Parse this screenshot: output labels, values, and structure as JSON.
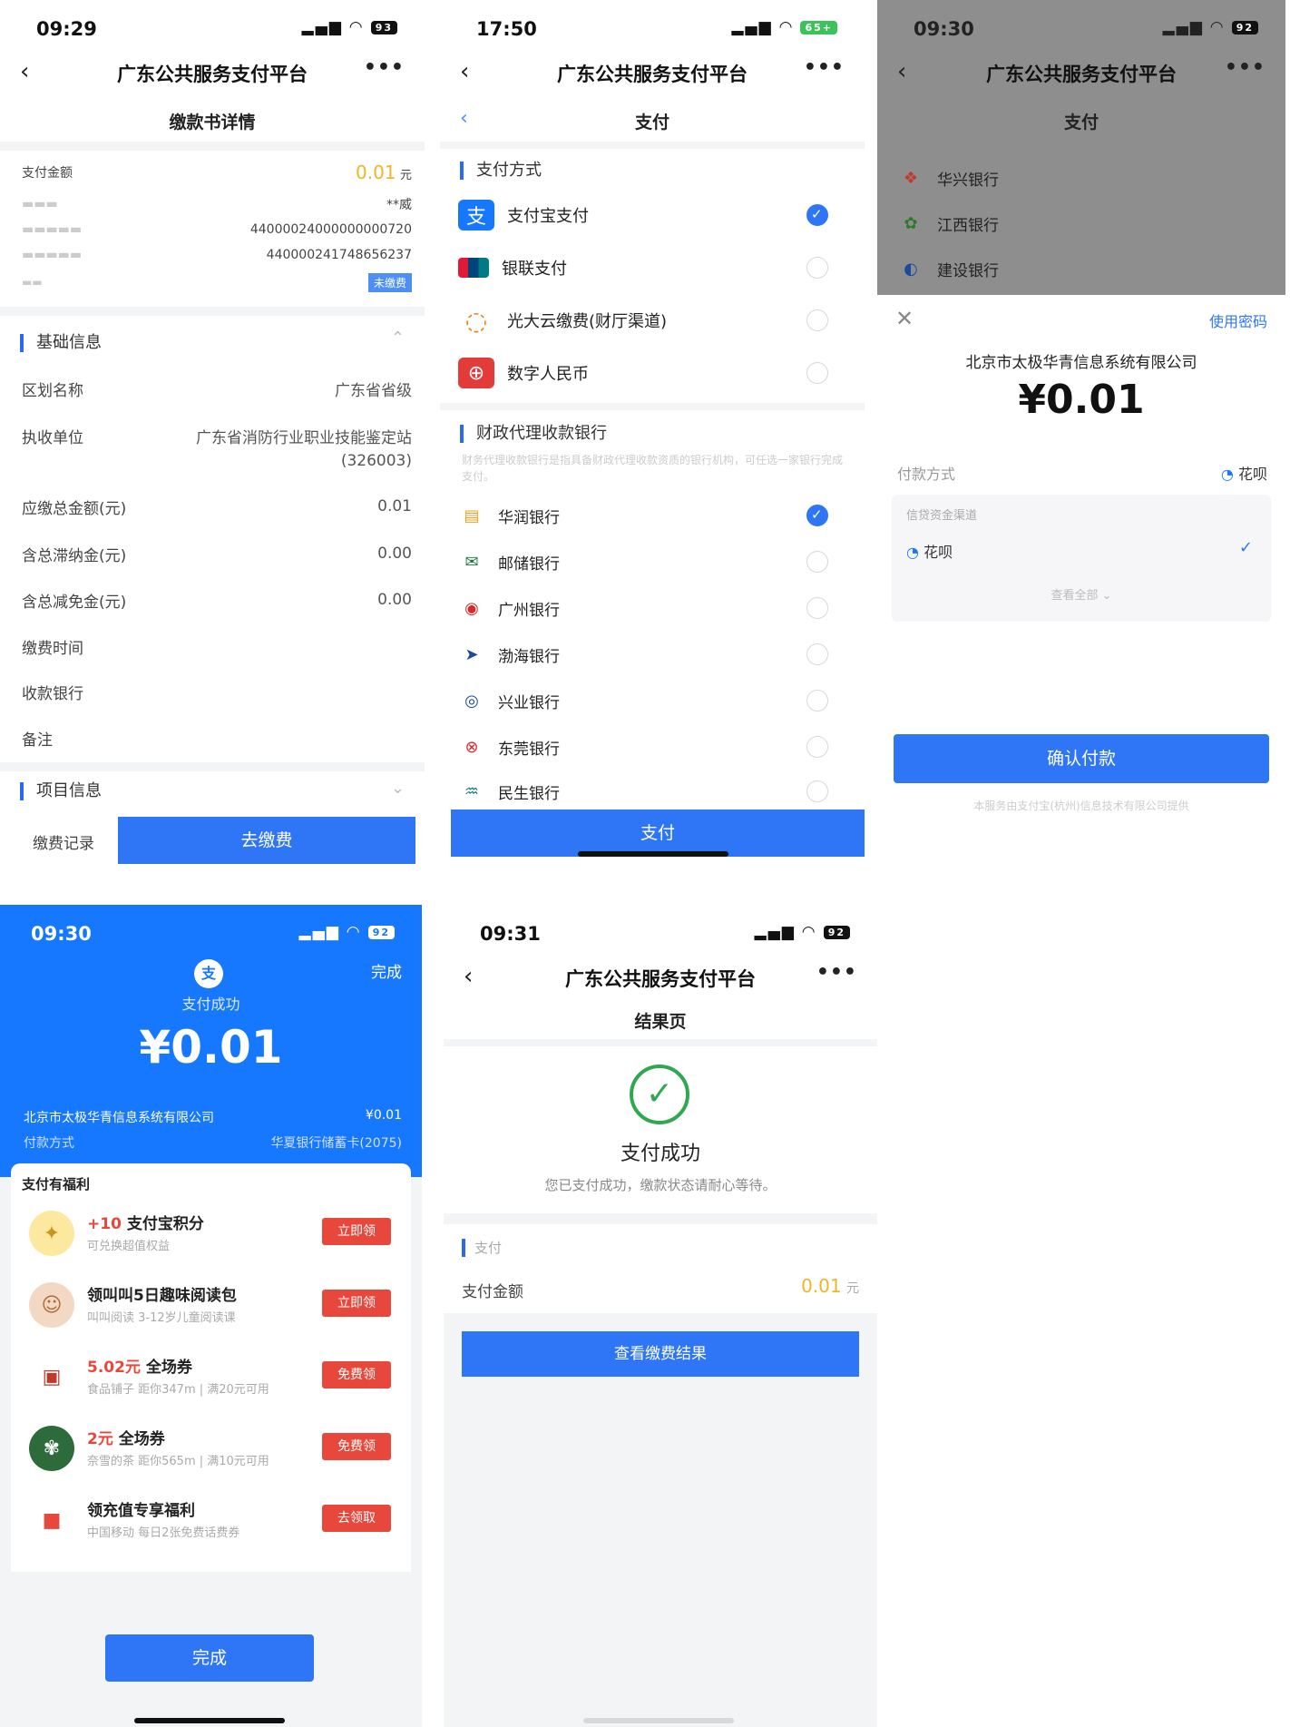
{
  "p1": {
    "time": "09:29",
    "battery": "93",
    "nav_title": "广东公共服务支付平台",
    "sub_title": "缴款书详情",
    "pay_amount_label": "支付金额",
    "pay_amount": "0.01",
    "yuan": "元",
    "payer_value": "**威",
    "no1": "44000024000000000720",
    "no2": "440000241748656237",
    "status_badge": "未缴费",
    "basic_title": "基础信息",
    "rows": [
      {
        "k": "区划名称",
        "v": "广东省省级"
      },
      {
        "k": "执收单位",
        "v": "广东省消防行业职业技能鉴定站"
      },
      {
        "k": "",
        "v": "(326003)"
      },
      {
        "k": "应缴总金额(元)",
        "v": "0.01"
      },
      {
        "k": "含总滞纳金(元)",
        "v": "0.00"
      },
      {
        "k": "含总减免金(元)",
        "v": "0.00"
      },
      {
        "k": "缴费时间",
        "v": ""
      },
      {
        "k": "收款银行",
        "v": ""
      },
      {
        "k": "备注",
        "v": ""
      }
    ],
    "project_title": "项目信息",
    "record_label": "缴费记录",
    "pay_btn": "去缴费"
  },
  "p2": {
    "time": "17:50",
    "battery": "65+",
    "nav_title": "广东公共服务支付平台",
    "sub_title": "支付",
    "method_title": "支付方式",
    "methods": [
      {
        "label": "支付宝支付",
        "icon": "alipay-icon",
        "on": true
      },
      {
        "label": "银联支付",
        "icon": "unionpay-icon",
        "on": false
      },
      {
        "label": "光大云缴费(财厅渠道)",
        "icon": "cloud-pay-icon",
        "on": false
      },
      {
        "label": "数字人民币",
        "icon": "ecny-icon",
        "on": false
      }
    ],
    "bank_title": "财政代理收款银行",
    "bank_desc": "财务代理收款银行是指具备财政代理收款资质的银行机构，可任选一家银行完成支付。",
    "banks": [
      {
        "label": "华润银行",
        "icon": "huarun-bank-icon",
        "on": true
      },
      {
        "label": "邮储银行",
        "icon": "psbc-icon",
        "on": false
      },
      {
        "label": "广州银行",
        "icon": "gz-bank-icon",
        "on": false
      },
      {
        "label": "渤海银行",
        "icon": "bohai-bank-icon",
        "on": false
      },
      {
        "label": "兴业银行",
        "icon": "cib-icon",
        "on": false
      },
      {
        "label": "东莞银行",
        "icon": "dg-bank-icon",
        "on": false
      },
      {
        "label": "民生银行",
        "icon": "cmbc-icon",
        "on": false
      }
    ],
    "pay_btn": "支付"
  },
  "p3": {
    "time": "09:30",
    "battery": "92",
    "nav_title": "广东公共服务支付平台",
    "sub_title": "支付",
    "banks": [
      "华兴银行",
      "江西银行",
      "建设银行"
    ],
    "use_password": "使用密码",
    "merchant": "北京市太极华青信息系统有限公司",
    "amount": "¥0.01",
    "pay_method_label": "付款方式",
    "pay_method_value": "花呗",
    "credit_label": "信贷资金渠道",
    "credit_option": "花呗",
    "view_all": "查看全部",
    "confirm_btn": "确认付款",
    "footer": "本服务由支付宝(杭州)信息技术有限公司提供"
  },
  "p4": {
    "time": "09:30",
    "battery": "92",
    "done_top": "完成",
    "success": "支付成功",
    "amount": "¥0.01",
    "merchant": "北京市太极华青信息系统有限公司",
    "merchant_amount": "¥0.01",
    "pay_method_label": "付款方式",
    "pay_method_value": "华夏银行储蓄卡(2075)",
    "welfare_title": "支付有福利",
    "welfare": [
      {
        "title_red": "+10",
        "title": "支付宝积分",
        "desc": "可兑换超值权益",
        "btn": "立即领",
        "icon": "points-icon"
      },
      {
        "title_red": "",
        "title": "领叫叫5日趣味阅读包",
        "desc": "叫叫阅读  3-12岁儿童阅读课",
        "btn": "立即领",
        "icon": "reading-icon"
      },
      {
        "title_red": "5.02元",
        "title": "全场券",
        "desc": "食品铺子  距你347m | 满20元可用",
        "btn": "免费领",
        "icon": "coupon-icon"
      },
      {
        "title_red": "2元",
        "title": "全场券",
        "desc": "奈雪的茶  距你565m | 满10元可用",
        "btn": "免费领",
        "icon": "tea-icon"
      },
      {
        "title_red": "",
        "title": "领充值专享福利",
        "desc": "中国移动  每日2张免费话费券",
        "btn": "去领取",
        "icon": "gift-icon"
      }
    ],
    "done_btn": "完成"
  },
  "p5": {
    "time": "09:31",
    "battery": "92",
    "nav_title": "广东公共服务支付平台",
    "sub_title": "结果页",
    "success": "支付成功",
    "desc": "您已支付成功，缴款状态请耐心等待。",
    "pay_section": "支付",
    "amount_label": "支付金额",
    "amount": "0.01",
    "yuan": "元",
    "result_btn": "查看缴费结果"
  }
}
